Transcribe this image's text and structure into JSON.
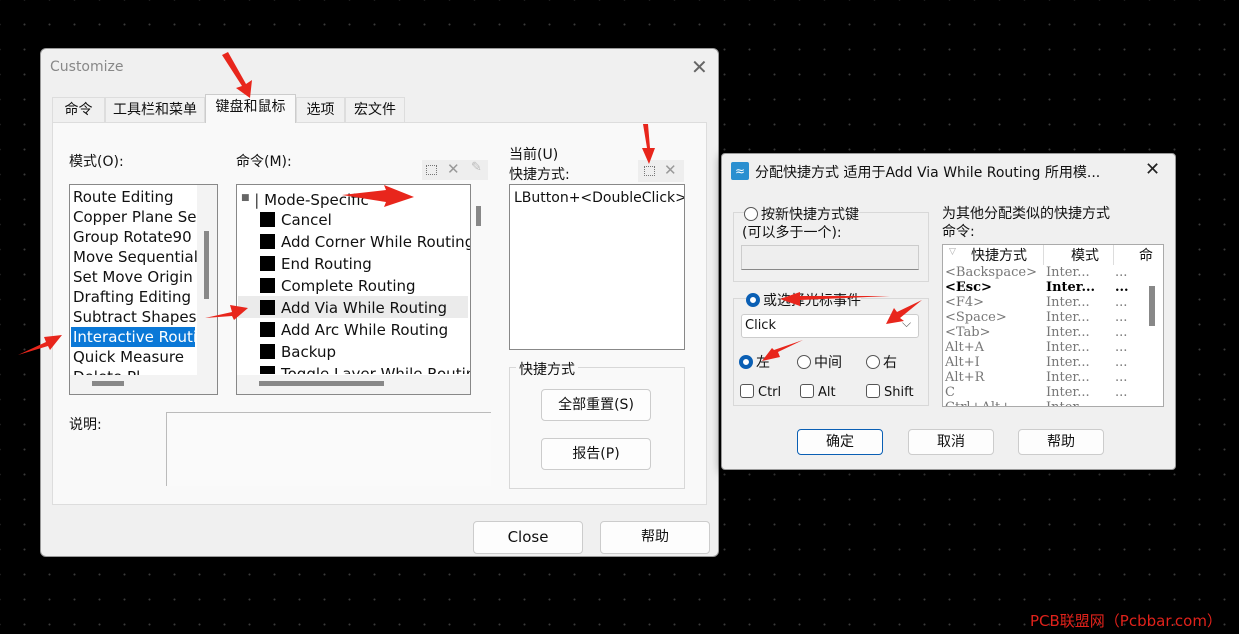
{
  "customize": {
    "title": "Customize",
    "tabs": [
      "命令",
      "工具栏和菜单",
      "键盘和鼠标",
      "选项",
      "宏文件"
    ],
    "active_tab": "键盘和鼠标",
    "mode_label": "模式(O):",
    "modes": [
      "Route Editing",
      "Copper Plane Se",
      "Group Rotate90",
      "Move Sequential",
      "Set Move Origin",
      "Drafting Editing",
      "Subtract Shapes",
      "Interactive Routi",
      "Quick Measure",
      "Delete Pl..."
    ],
    "selected_mode": "Interactive Routi",
    "command_label": "命令(M):",
    "command_group": "Mode-Specific",
    "commands": [
      "Cancel",
      "Add Corner While Routing",
      "End Routing",
      "Complete Routing",
      "Add Via While Routing",
      "Add Arc While Routing",
      "Backup",
      "Toggle Layer While Routing"
    ],
    "selected_command": "Add Via While Routing",
    "current_label": "当前(U)",
    "shortcut_label": "快捷方式:",
    "current_shortcut": "LButton+<DoubleClick>",
    "shortcut_group_label": "快捷方式",
    "reset_all": "全部重置(S)",
    "report": "报告(P)",
    "description_label": "说明:",
    "close": "Close",
    "help": "帮助"
  },
  "assign": {
    "title": "分配快捷方式 适用于Add Via While Routing 所用模...",
    "press_key_radio": "按新快捷方式键",
    "press_key_hint": "(可以多于一个):",
    "mouse_event_radio": "或选择光标事件",
    "mouse_event_value": "Click",
    "buttons": {
      "left": "左",
      "middle": "中间",
      "right": "右"
    },
    "selected_button": "左",
    "modifiers": {
      "ctrl": "Ctrl",
      "alt": "Alt",
      "shift": "Shift"
    },
    "similar_label_1": "为其他分配类似的快捷方式",
    "similar_label_2": "命令:",
    "columns": [
      "快捷方式",
      "模式",
      "命"
    ],
    "rows": [
      {
        "key": "<Backspace>",
        "mode": "Inter...",
        "cmd": "..."
      },
      {
        "key": "<Esc>",
        "mode": "Inter...",
        "cmd": "..."
      },
      {
        "key": "<F4>",
        "mode": "Inter...",
        "cmd": "..."
      },
      {
        "key": "<Space>",
        "mode": "Inter...",
        "cmd": "..."
      },
      {
        "key": "<Tab>",
        "mode": "Inter...",
        "cmd": "..."
      },
      {
        "key": "Alt+A",
        "mode": "Inter...",
        "cmd": "..."
      },
      {
        "key": "Alt+I",
        "mode": "Inter...",
        "cmd": "..."
      },
      {
        "key": "Alt+R",
        "mode": "Inter...",
        "cmd": "..."
      },
      {
        "key": "C",
        "mode": "Inter...",
        "cmd": "..."
      },
      {
        "key": "Ctrl+Alt+...",
        "mode": "Inter...",
        "cmd": "..."
      }
    ],
    "ok": "确定",
    "cancel": "取消",
    "help": "帮助"
  },
  "watermark": "PCB联盟网（Pcbbar.com）",
  "colors": {
    "selection": "#0a78d7",
    "accent": "#0a5fb4",
    "annotation": "#e8261c",
    "watermark": "#e0221b"
  }
}
